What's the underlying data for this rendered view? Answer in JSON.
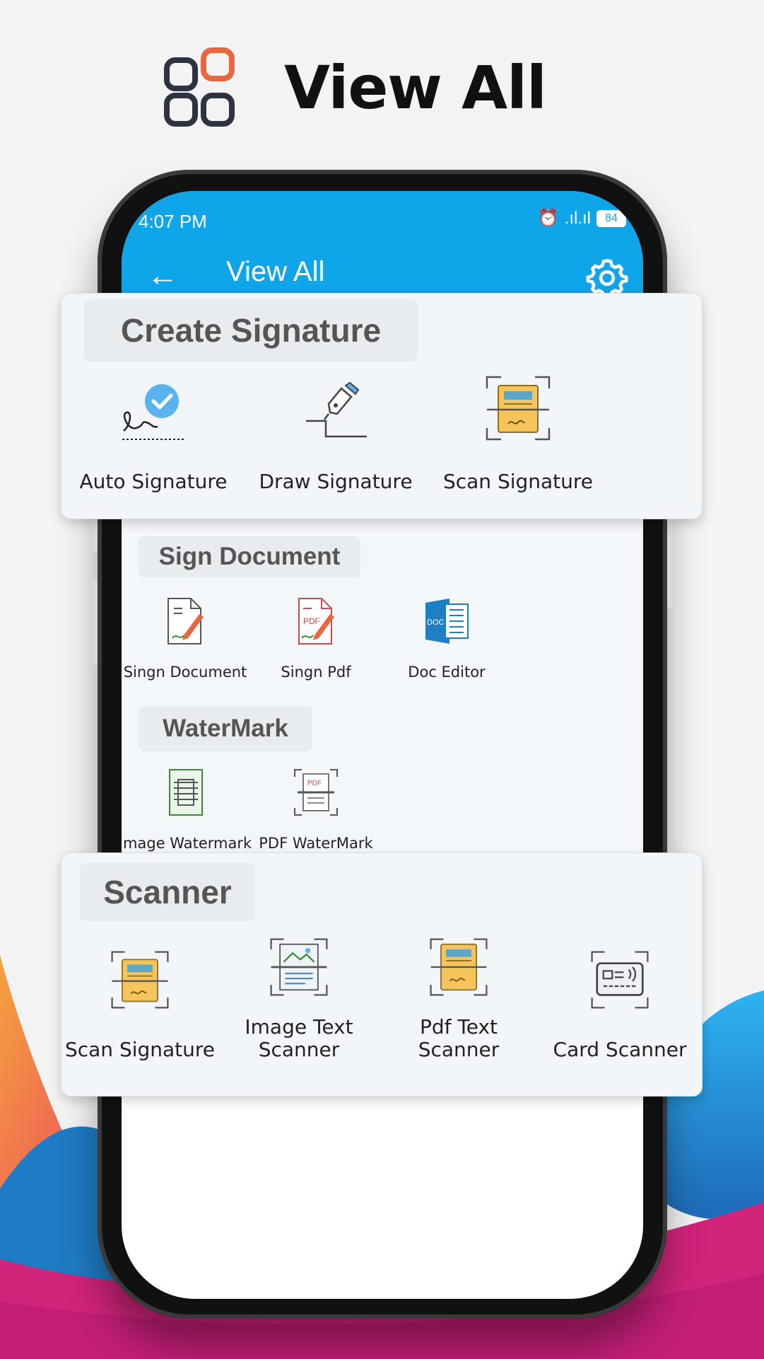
{
  "header": {
    "title": "View All"
  },
  "status_bar": {
    "time": "4:07 PM",
    "battery": "84"
  },
  "app_bar": {
    "title": "View All"
  },
  "sections": {
    "create_signature": {
      "title": "Create Signature",
      "tools": [
        "Auto Signature",
        "Draw Signature",
        "Scan Signature"
      ]
    },
    "sign_document": {
      "title": "Sign Document",
      "tools": [
        "Singn Document",
        "Singn Pdf",
        "Doc Editor"
      ]
    },
    "watermark": {
      "title": "WaterMark",
      "tools": [
        "Image Watermark",
        "PDF WaterMark"
      ]
    },
    "scanner": {
      "title": "Scanner",
      "tools": [
        "Scan Signature",
        "Image Text\nScanner",
        "Pdf Text\nScanner",
        "Card Scanner"
      ]
    }
  },
  "icon_labels": {
    "pdf": "PDF",
    "doc": "DOC"
  },
  "colors": {
    "app_bar": "#0ea5e9",
    "brand_orange": "#e8673f",
    "icon_dark": "#2d3340",
    "doc_yellow": "#f6c45a",
    "doc_blue": "#1f7fc4",
    "bg_magenta": "#d1247b",
    "bg_blue": "#1f9de0"
  }
}
